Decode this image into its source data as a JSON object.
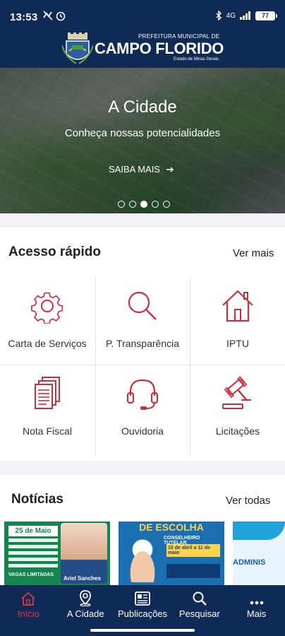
{
  "status_bar": {
    "time": "13:53",
    "network": "4G",
    "battery": "77"
  },
  "header": {
    "logo_sub": "PREFEITURA MUNICIPAL DE",
    "logo_main": "CAMPO FLORIDO",
    "logo_state": "Estado de Minas Gerais"
  },
  "hero": {
    "title": "A Cidade",
    "subtitle": "Conheça nossas potencialidades",
    "cta": "SAIBA MAIS",
    "slides_total": 5,
    "slide_active": 3
  },
  "quick_access": {
    "title": "Acesso rápido",
    "more": "Ver mais",
    "items": [
      {
        "label": "Carta de Serviços",
        "icon": "gear-icon"
      },
      {
        "label": "P. Transparência",
        "icon": "search-icon"
      },
      {
        "label": "IPTU",
        "icon": "house-icon"
      },
      {
        "label": "Nota Fiscal",
        "icon": "documents-icon"
      },
      {
        "label": "Ouvidoria",
        "icon": "headset-icon"
      },
      {
        "label": "Licitações",
        "icon": "gavel-icon"
      }
    ]
  },
  "news": {
    "title": "Notícias",
    "more": "Ver todas",
    "cards": [
      {
        "date_text": "25 de Maio",
        "name_text": "Ariel Sanches",
        "vagas_text": "VAGAS LIMITADAS"
      },
      {
        "headline": "DE ESCOLHA",
        "body_title": "CONSELHEIRO TUTELAR",
        "dates": "10 de abril a 11 de maio"
      },
      {
        "partial_text": "ADMINIS"
      }
    ]
  },
  "bottom_nav": {
    "items": [
      {
        "label": "Início",
        "icon": "home-icon"
      },
      {
        "label": "A Cidade",
        "icon": "location-pin-icon"
      },
      {
        "label": "Publicações",
        "icon": "newspaper-icon"
      },
      {
        "label": "Pesquisar",
        "icon": "search-icon"
      },
      {
        "label": "Mais",
        "icon": "more-dots-icon"
      }
    ]
  },
  "colors": {
    "navy": "#0e2a55",
    "accent_red": "#c8303e",
    "active_nav": "#e0334a"
  }
}
